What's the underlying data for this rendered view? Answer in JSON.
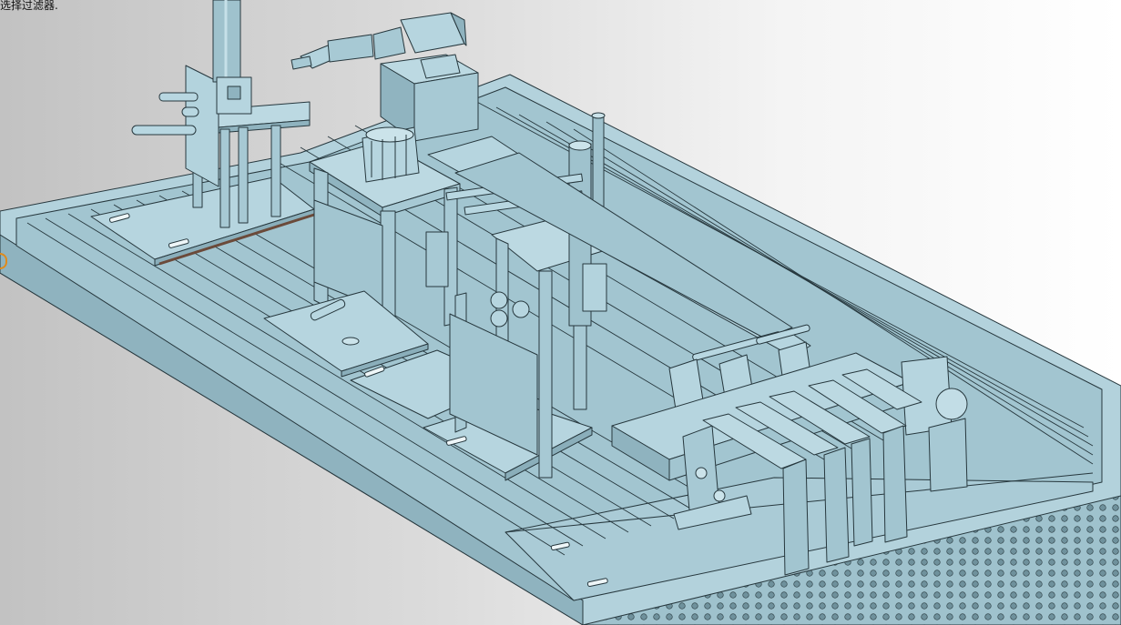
{
  "status_bar": {
    "hint_text": "选择过滤器."
  },
  "viewport": {
    "model_color": "#a7c9d4",
    "edge_color": "#27383e",
    "dark_face": "#86aab6",
    "light_face": "#bfdbe4",
    "background_left": "#c2c2c2",
    "background_right": "#ffffff",
    "orientation_marker_color": "#e08a1a"
  }
}
